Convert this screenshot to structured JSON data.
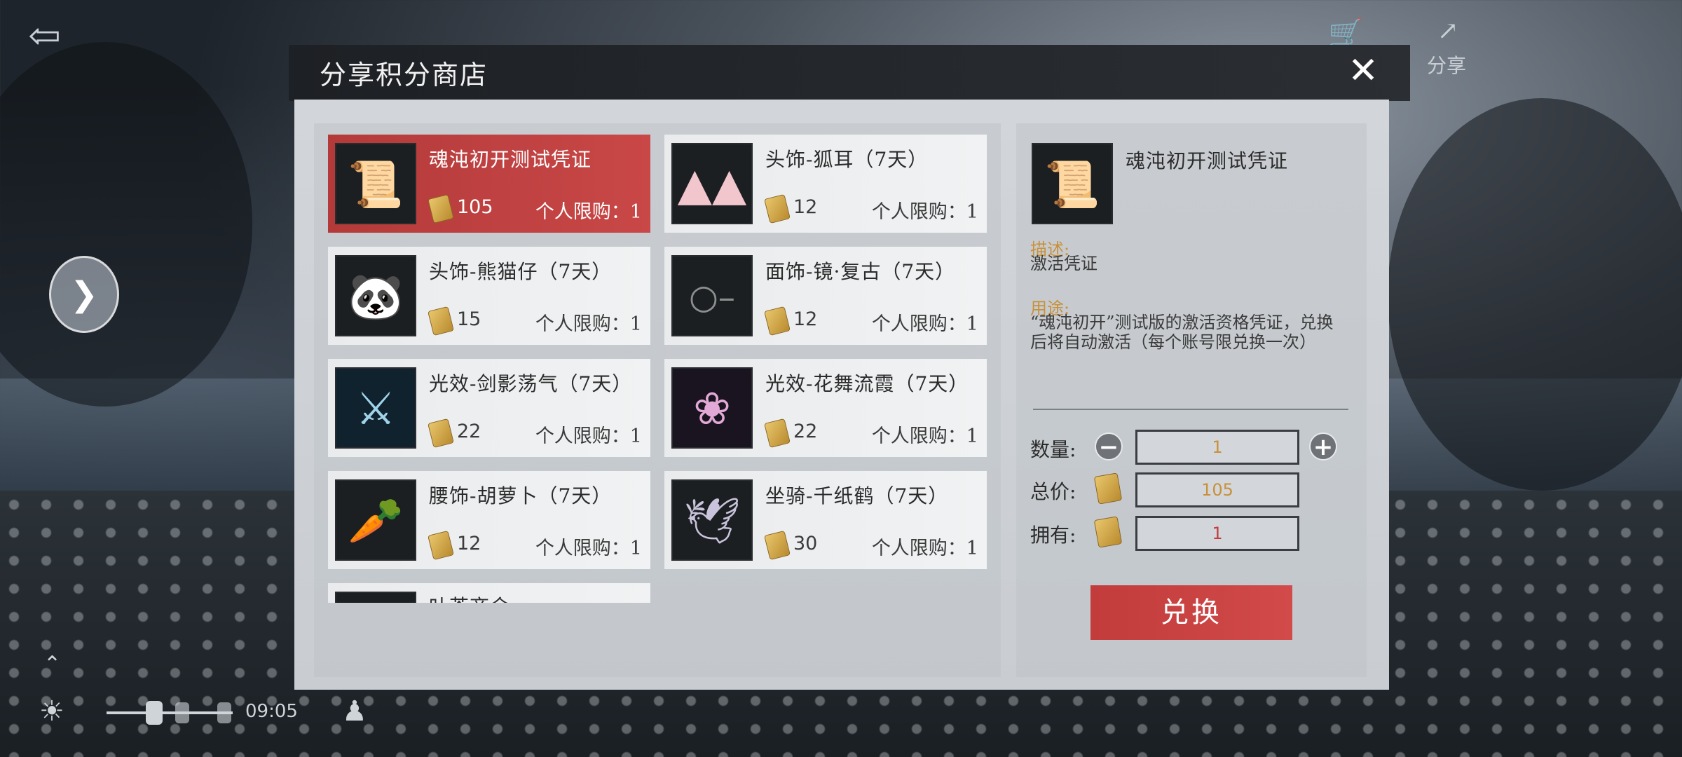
{
  "top": {
    "share_label": "分享",
    "back_icon": "back-arrow-icon",
    "cart_icon": "cart-icon",
    "share_icon": "share-icon"
  },
  "hud": {
    "time": "09:05",
    "up_icon": "chevron-up-icon",
    "weather_icon": "sun-icon",
    "figure_icon": "figure-icon"
  },
  "dialog": {
    "title": "分享积分商店",
    "close_icon": "close-icon"
  },
  "items": [
    {
      "name": "魂沌初开测试凭证",
      "price": "105",
      "limit": "个人限购：1",
      "icon": "voucher-icon",
      "selected": true
    },
    {
      "name": "头饰-狐耳（7天）",
      "price": "12",
      "limit": "个人限购：1",
      "icon": "fox-ears-icon"
    },
    {
      "name": "头饰-熊猫仔（7天）",
      "price": "15",
      "limit": "个人限购：1",
      "icon": "panda-icon"
    },
    {
      "name": "面饰-镜·复古（7天）",
      "price": "12",
      "limit": "个人限购：1",
      "icon": "monocle-icon"
    },
    {
      "name": "光效-剑影荡气（7天）",
      "price": "22",
      "limit": "个人限购：1",
      "icon": "sword-effect-icon"
    },
    {
      "name": "光效-花舞流霞（7天）",
      "price": "22",
      "limit": "个人限购：1",
      "icon": "flower-effect-icon"
    },
    {
      "name": "腰饰-胡萝卜（7天）",
      "price": "12",
      "limit": "个人限购：1",
      "icon": "carrot-icon"
    },
    {
      "name": "坐骑-千纸鹤（7天）",
      "price": "30",
      "limit": "个人限购：1",
      "icon": "paper-crane-icon"
    }
  ],
  "partial_item": {
    "name": "叶茶商会"
  },
  "detail": {
    "name": "魂沌初开测试凭证",
    "desc_label": "描述:",
    "desc": "激活凭证",
    "use_label": "用途:",
    "use_text": "“魂沌初开”测试版的激活资格凭证，兑换后将自动激活（每个账号限兑换一次）",
    "quantity_label": "数量:",
    "quantity_value": "1",
    "total_label": "总价:",
    "total_value": "105",
    "own_label": "拥有:",
    "own_value": "1",
    "minus_label": "−",
    "plus_label": "+",
    "exchange_label": "兑换"
  },
  "colors": {
    "selected": "#c94747",
    "accent_gold": "#c8913a",
    "own_value_color": "#c23c3c"
  }
}
